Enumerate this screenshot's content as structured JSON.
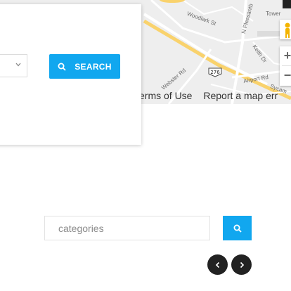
{
  "map": {
    "streets": [
      {
        "name": "Woodlark St"
      },
      {
        "name": "N Pleasantb"
      },
      {
        "name": "Tower"
      },
      {
        "name": "Keith Dr"
      },
      {
        "name": "Webster Rd"
      },
      {
        "name": "Airport Rd"
      },
      {
        "name": "Sycam"
      }
    ],
    "route_shield": "276",
    "terms_label": "erms of Use",
    "report_label": "Report a map err",
    "zoom_in": "+",
    "zoom_out": "−"
  },
  "search_panel": {
    "search_button_label": "SEARCH"
  },
  "categories": {
    "placeholder": "categories"
  },
  "colors": {
    "accent": "#11a7ef",
    "nav_button": "#222222",
    "map_background": "#eeeeee",
    "highway": "#f9d26c"
  },
  "icons": [
    "search-icon",
    "chevron-down-icon",
    "chevron-left-icon",
    "chevron-right-icon",
    "pegman-icon",
    "fullscreen-icon"
  ]
}
